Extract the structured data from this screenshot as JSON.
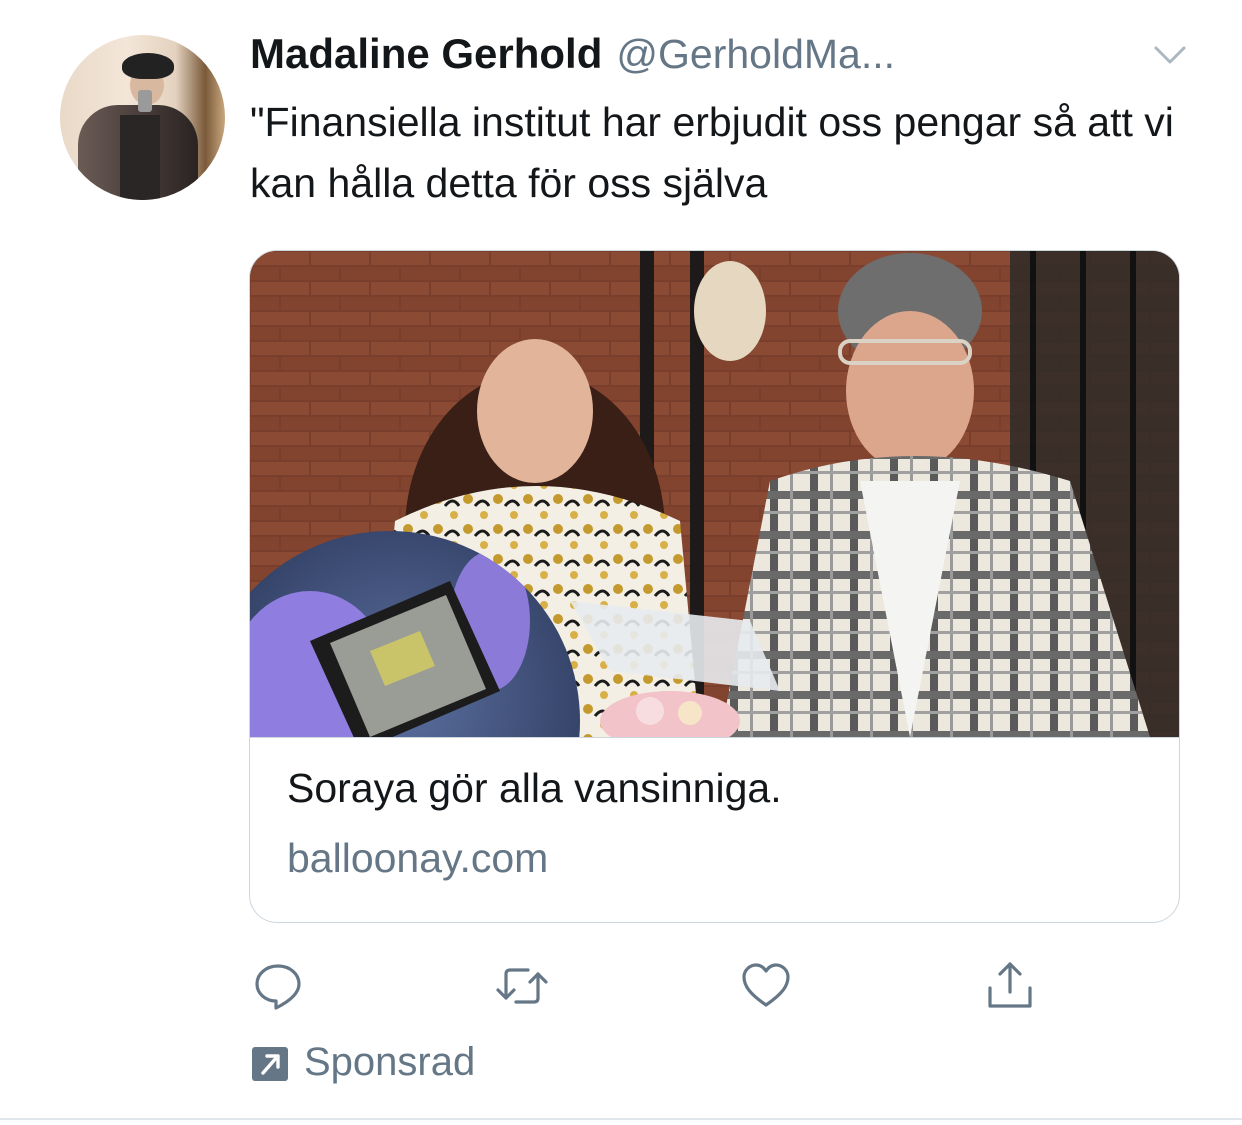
{
  "tweet": {
    "author_name": "Madaline Gerhold",
    "author_handle": "@GerholdMa...",
    "text": "\"Finansiella institut har erbjudit oss pengar så att vi kan hålla detta för oss själva",
    "menu_icon": "chevron-down-icon",
    "avatar_icon": "avatar"
  },
  "card": {
    "title": "Soraya gör alla vansinniga.",
    "domain": "balloonay.com",
    "image": "studio-photo-with-chip-inset"
  },
  "actions": [
    {
      "icon": "reply-icon"
    },
    {
      "icon": "retweet-icon"
    },
    {
      "icon": "like-icon"
    },
    {
      "icon": "share-icon"
    }
  ],
  "promoted": {
    "icon": "promoted-arrow-icon",
    "label": "Sponsrad"
  },
  "colors": {
    "text_primary": "#14171a",
    "text_secondary": "#657786",
    "border": "#ccd6dd",
    "icon": "#657786"
  }
}
